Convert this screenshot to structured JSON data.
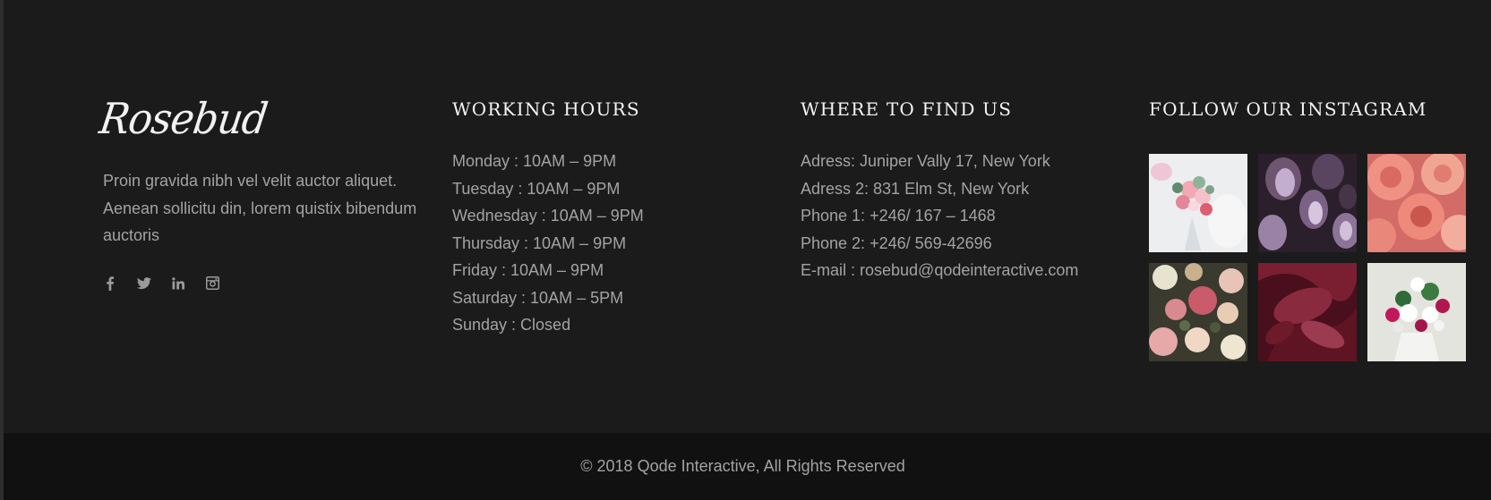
{
  "brand": {
    "logo_text": "Rosebud",
    "about": "Proin gravida nibh vel velit auctor aliquet. Aenean sollicitu din, lorem quistix bibendum auctoris"
  },
  "socials": [
    {
      "icon": "facebook-icon",
      "glyph": "f"
    },
    {
      "icon": "twitter-icon",
      "glyph": "t"
    },
    {
      "icon": "linkedin-icon",
      "glyph": "in"
    },
    {
      "icon": "instagram-icon",
      "glyph": "ig"
    }
  ],
  "working_hours": {
    "title": "WORKING HOURS",
    "items": [
      "Monday : 10AM – 9PM",
      "Tuesday : 10AM – 9PM",
      "Wednesday : 10AM – 9PM",
      "Thursday : 10AM – 9PM",
      "Friday : 10AM – 9PM",
      "Saturday : 10AM – 5PM",
      "Sunday : Closed"
    ]
  },
  "find_us": {
    "title": "WHERE TO FIND US",
    "items": [
      "Adress: Juniper Vally 17, New York",
      "Adress 2: 831 Elm St, New York",
      "Phone 1: +246/ 167 – 1468",
      "Phone 2: +246/ 569-42696",
      "E-mail : rosebud@qodeinteractive.com"
    ]
  },
  "instagram": {
    "title": "FOLLOW OUR INSTAGRAM",
    "images": [
      {
        "name": "bouquet-white-photo"
      },
      {
        "name": "purple-tulips-photo"
      },
      {
        "name": "pink-roses-photo"
      },
      {
        "name": "mixed-roses-photo"
      },
      {
        "name": "dark-red-petals-photo"
      },
      {
        "name": "white-lily-bouquet-photo"
      }
    ]
  },
  "footer": {
    "copyright": "© 2018 Qode Interactive, All Rights Reserved"
  },
  "colors": {
    "background": "#1b1b1b",
    "bottom_bar": "#111111",
    "text": "#a3a3a3",
    "heading": "#f4f4f4"
  }
}
